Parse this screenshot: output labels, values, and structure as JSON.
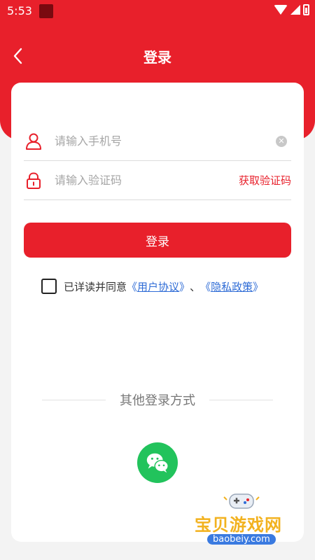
{
  "status_bar": {
    "time": "5:53"
  },
  "header": {
    "title": "登录",
    "back_icon": "chevron-left-icon"
  },
  "form": {
    "phone": {
      "placeholder": "请输入手机号",
      "value": "",
      "icon": "user-icon",
      "clear_icon": "clear-icon"
    },
    "code": {
      "placeholder": "请输入验证码",
      "value": "",
      "icon": "lock-icon",
      "get_code_label": "获取验证码"
    },
    "login_label": "登录",
    "agreement": {
      "checked": false,
      "prefix": "已详读并同意",
      "open_bracket": "《",
      "close_bracket": "》",
      "user_agreement": "用户协议",
      "separator": "、",
      "privacy_policy": "隐私政策"
    }
  },
  "other_login": {
    "title": "其他登录方式",
    "wechat_icon": "wechat-icon"
  },
  "watermark": {
    "text": "宝贝游戏网",
    "url": "baobeiy.com"
  },
  "colors": {
    "primary": "#e8202b",
    "link": "#2f6cd6",
    "wechat": "#22c35c"
  }
}
